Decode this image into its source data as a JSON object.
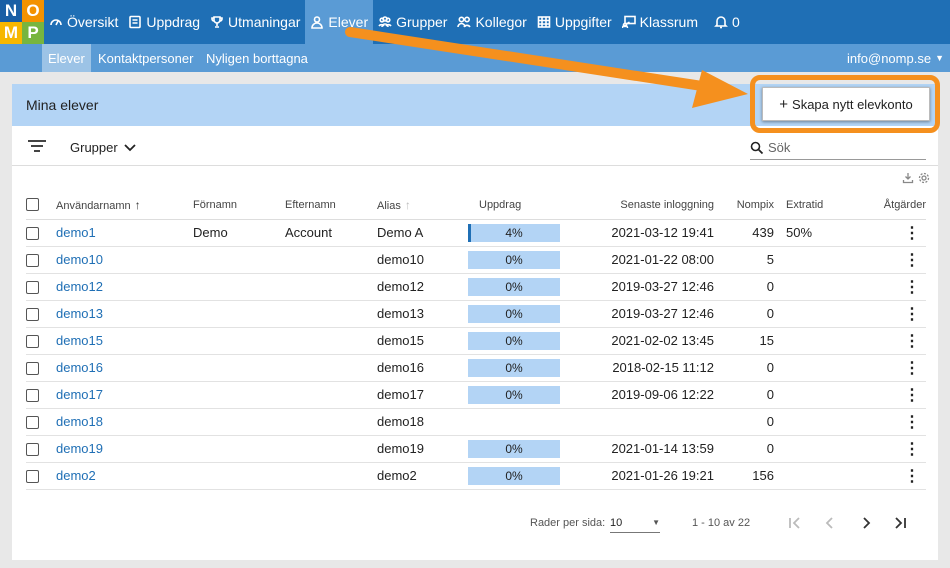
{
  "logo": {
    "letters": [
      "N",
      "O",
      "M",
      "P"
    ]
  },
  "nav": {
    "items": [
      {
        "label": "Översikt",
        "icon": "dashboard-icon"
      },
      {
        "label": "Uppdrag",
        "icon": "tasks-icon"
      },
      {
        "label": "Utmaningar",
        "icon": "trophy-icon"
      },
      {
        "label": "Elever",
        "icon": "user-icon"
      },
      {
        "label": "Grupper",
        "icon": "groups-icon"
      },
      {
        "label": "Kollegor",
        "icon": "colleagues-icon"
      },
      {
        "label": "Uppgifter",
        "icon": "table-icon"
      },
      {
        "label": "Klassrum",
        "icon": "classroom-icon"
      },
      {
        "label": "0",
        "icon": "bell-icon"
      }
    ],
    "active": "Elever"
  },
  "subnav": {
    "items": [
      "Elever",
      "Kontaktpersoner",
      "Nyligen borttagna"
    ],
    "active": "Elever",
    "user": "info@nomp.se"
  },
  "panel": {
    "title": "Mina elever",
    "create_button": "Skapa nytt elevkonto",
    "groups_label": "Grupper",
    "search_placeholder": "Sök"
  },
  "table": {
    "headers": {
      "username": "Användarnamn",
      "firstname": "Förnamn",
      "lastname": "Efternamn",
      "alias": "Alias",
      "missions": "Uppdrag",
      "last_login": "Senaste inloggning",
      "nompix": "Nompix",
      "extra_time": "Extratid",
      "actions": "Åtgärder"
    },
    "rows": [
      {
        "username": "demo1",
        "firstname": "Demo",
        "lastname": "Account",
        "alias": "Demo A",
        "progress": "4%",
        "progress_value": 4,
        "last_login": "2021-03-12 19:41",
        "nompix": "439",
        "extra_time": "50%"
      },
      {
        "username": "demo10",
        "firstname": "",
        "lastname": "",
        "alias": "demo10",
        "progress": "0%",
        "progress_value": 0,
        "last_login": "2021-01-22 08:00",
        "nompix": "5",
        "extra_time": ""
      },
      {
        "username": "demo12",
        "firstname": "",
        "lastname": "",
        "alias": "demo12",
        "progress": "0%",
        "progress_value": 0,
        "last_login": "2019-03-27 12:46",
        "nompix": "0",
        "extra_time": ""
      },
      {
        "username": "demo13",
        "firstname": "",
        "lastname": "",
        "alias": "demo13",
        "progress": "0%",
        "progress_value": 0,
        "last_login": "2019-03-27 12:46",
        "nompix": "0",
        "extra_time": ""
      },
      {
        "username": "demo15",
        "firstname": "",
        "lastname": "",
        "alias": "demo15",
        "progress": "0%",
        "progress_value": 0,
        "last_login": "2021-02-02 13:45",
        "nompix": "15",
        "extra_time": ""
      },
      {
        "username": "demo16",
        "firstname": "",
        "lastname": "",
        "alias": "demo16",
        "progress": "0%",
        "progress_value": 0,
        "last_login": "2018-02-15 11:12",
        "nompix": "0",
        "extra_time": ""
      },
      {
        "username": "demo17",
        "firstname": "",
        "lastname": "",
        "alias": "demo17",
        "progress": "0%",
        "progress_value": 0,
        "last_login": "2019-09-06 12:22",
        "nompix": "0",
        "extra_time": ""
      },
      {
        "username": "demo18",
        "firstname": "",
        "lastname": "",
        "alias": "demo18",
        "progress": "",
        "progress_value": null,
        "last_login": "",
        "nompix": "0",
        "extra_time": ""
      },
      {
        "username": "demo19",
        "firstname": "",
        "lastname": "",
        "alias": "demo19",
        "progress": "0%",
        "progress_value": 0,
        "last_login": "2021-01-14 13:59",
        "nompix": "0",
        "extra_time": ""
      },
      {
        "username": "demo2",
        "firstname": "",
        "lastname": "",
        "alias": "demo2",
        "progress": "0%",
        "progress_value": 0,
        "last_login": "2021-01-26 19:21",
        "nompix": "156",
        "extra_time": ""
      }
    ]
  },
  "footer": {
    "rows_per_page_label": "Rader per sida:",
    "rows_per_page": "10",
    "range": "1 - 10 av 22"
  },
  "colors": {
    "primary": "#1f6fb5",
    "accent": "#f5901e",
    "header_bg": "#b3d4f5"
  }
}
